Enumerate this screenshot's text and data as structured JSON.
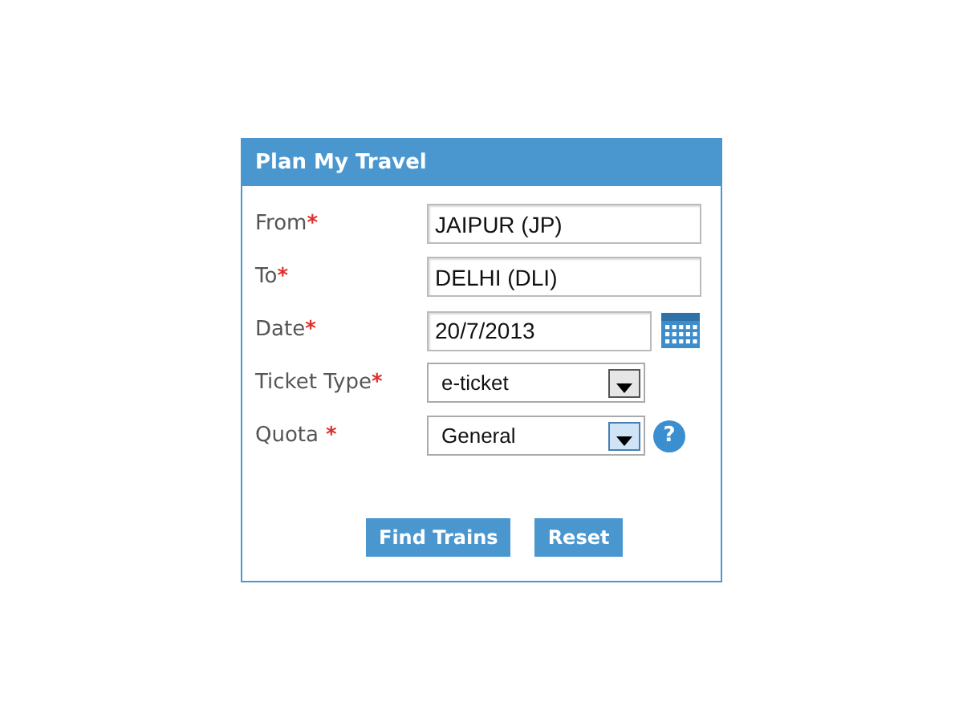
{
  "panel": {
    "title": "Plan My Travel"
  },
  "fields": [
    {
      "kind": "text",
      "label": "From",
      "mark": "*",
      "value": "JAIPUR (JP)"
    },
    {
      "kind": "text",
      "label": "To",
      "mark": "*",
      "value": "DELHI (DLI)"
    },
    {
      "kind": "date",
      "label": "Date",
      "mark": "*",
      "value": "20/7/2013"
    },
    {
      "kind": "select",
      "label": "Ticket Type",
      "mark": "*",
      "value": "e-ticket",
      "focused": false
    },
    {
      "kind": "select",
      "label": "Quota",
      "mark": " *",
      "value": "General",
      "focused": true,
      "help": "?"
    }
  ],
  "buttons": [
    "Find Trains",
    "Reset"
  ]
}
